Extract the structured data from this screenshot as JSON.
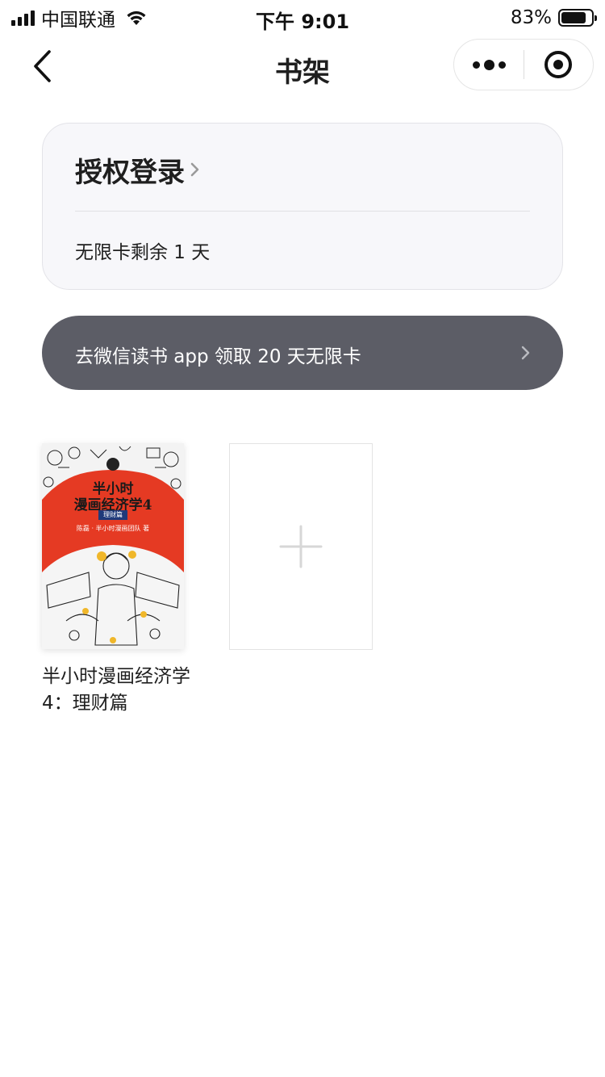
{
  "status_bar": {
    "carrier": "中国联通",
    "time": "下午 9:01",
    "battery": "83%",
    "battery_level": 0.83
  },
  "nav": {
    "title": "书架"
  },
  "login_card": {
    "title": "授权登录",
    "subtitle": "无限卡剩余 1 天"
  },
  "promo": {
    "text": "去微信读书 app 领取 20 天无限卡"
  },
  "shelf": {
    "books": [
      {
        "title": "半小时漫画经济学4：理财篇",
        "cover": {
          "line1": "半小时",
          "line2": "漫画经济学4",
          "tag": "理财篇",
          "author": "陈磊 · 半小时漫画团队 著"
        }
      }
    ]
  },
  "colors": {
    "promo_bg": "#5c5d66",
    "card_bg": "#f7f7fa",
    "cover_red": "#e53a23"
  },
  "icons": {
    "back": "chevron-left-icon",
    "more": "more-dots-icon",
    "close": "target-circle-icon",
    "add": "plus-icon"
  }
}
